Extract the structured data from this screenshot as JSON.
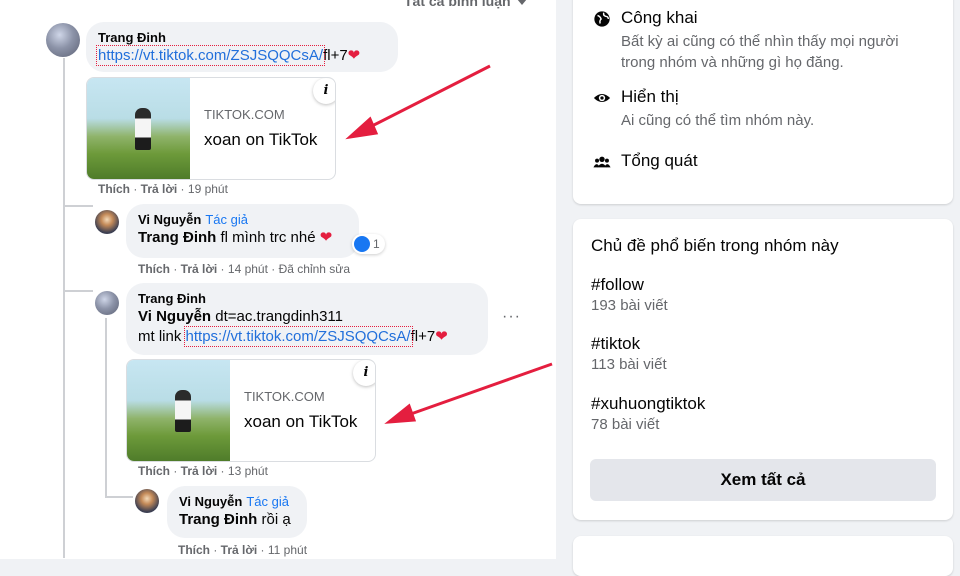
{
  "feed": {
    "filter_label": "Tất cả bình luận",
    "comments": [
      {
        "author": "Trang Đinh",
        "link": "https://vt.tiktok.com/ZSJSQQCsA/",
        "suffix": "fl+7",
        "card": {
          "domain": "TIKTOK.COM",
          "title": "xoan on TikTok"
        },
        "actions": {
          "like": "Thích",
          "reply": "Trả lời",
          "time": "19 phút"
        }
      },
      {
        "author": "Vi Nguyễn",
        "author_tag": "Tác giả",
        "mention": "Trang Đinh",
        "text": "fl mình trc nhé",
        "reaction_count": "1",
        "actions": {
          "like": "Thích",
          "reply": "Trả lời",
          "time": "14 phút",
          "edited": "Đã chỉnh sửa"
        }
      },
      {
        "author": "Trang Đinh",
        "mention": "Vi Nguyễn",
        "text_line1": "dt=ac.trangdinh311",
        "prefix": "mt link",
        "link": "https://vt.tiktok.com/ZSJSQQCsA/",
        "suffix": "fl+7",
        "card": {
          "domain": "TIKTOK.COM",
          "title": "xoan on TikTok"
        },
        "actions": {
          "like": "Thích",
          "reply": "Trả lời",
          "time": "13 phút"
        }
      },
      {
        "author": "Vi Nguyễn",
        "author_tag": "Tác giả",
        "mention": "Trang Đinh",
        "text": "rồi ạ",
        "actions": {
          "like": "Thích",
          "reply": "Trả lời",
          "time": "11 phút"
        }
      }
    ]
  },
  "sidebar": {
    "about": [
      {
        "icon": "globe-icon",
        "title": "Công khai",
        "desc": "Bất kỳ ai cũng có thể nhìn thấy mọi người trong nhóm và những gì họ đăng."
      },
      {
        "icon": "eye-icon",
        "title": "Hiển thị",
        "desc": "Ai cũng có thể tìm nhóm này."
      },
      {
        "icon": "people-icon",
        "title": "Tổng quát",
        "desc": ""
      }
    ],
    "topics": {
      "heading": "Chủ đề phổ biến trong nhóm này",
      "items": [
        {
          "name": "#follow",
          "count": "193 bài viết"
        },
        {
          "name": "#tiktok",
          "count": "113 bài viết"
        },
        {
          "name": "#xuhuongtiktok",
          "count": "78 bài viết"
        }
      ],
      "see_all": "Xem tất cả"
    }
  },
  "colors": {
    "accent": "#1877f2",
    "annotation_arrow": "#e41e3f",
    "link": "#216fdb"
  }
}
